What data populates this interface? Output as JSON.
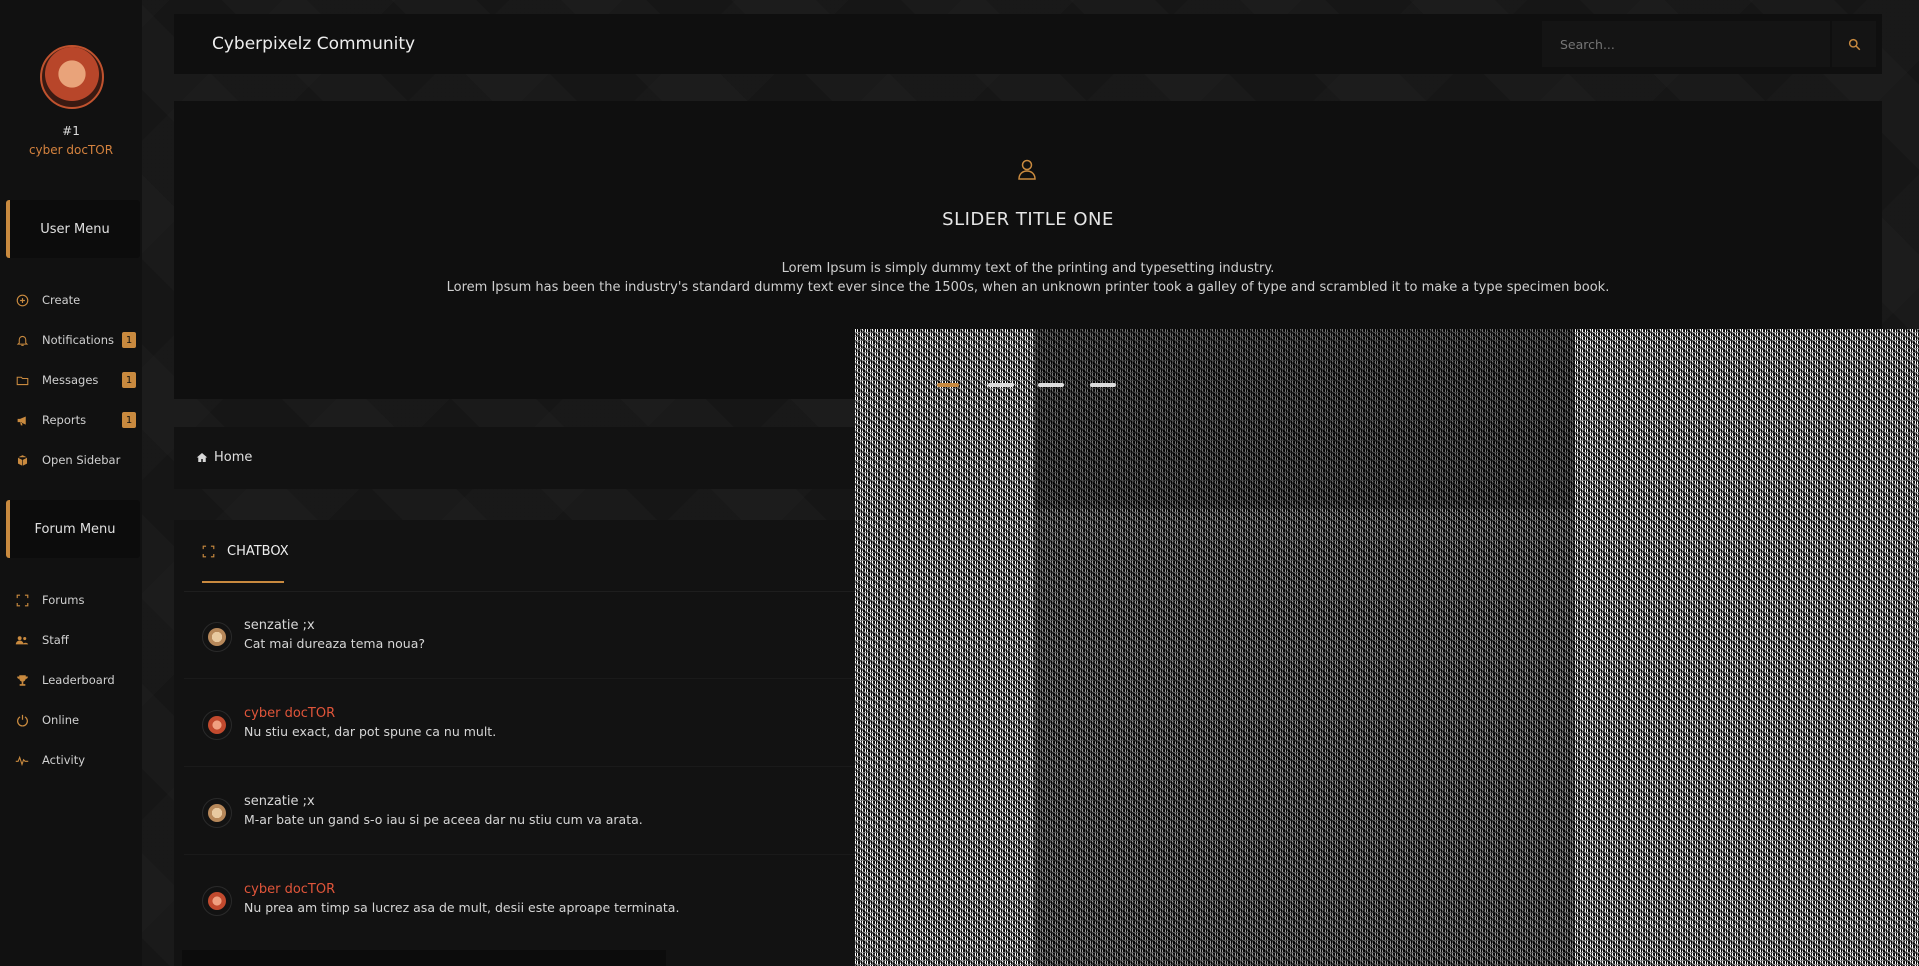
{
  "site": {
    "title": "Cyberpixelz Community"
  },
  "search": {
    "placeholder": "Search..."
  },
  "user": {
    "rank": "#1",
    "name": "cyber docTOR"
  },
  "user_menu": {
    "title": "User Menu",
    "items": [
      {
        "label": "Create",
        "icon": "plus-circle-icon",
        "badge": ""
      },
      {
        "label": "Notifications",
        "icon": "bell-icon",
        "badge": "1"
      },
      {
        "label": "Messages",
        "icon": "folder-icon",
        "badge": "1"
      },
      {
        "label": "Reports",
        "icon": "megaphone-icon",
        "badge": "1"
      },
      {
        "label": "Open Sidebar",
        "icon": "cube-icon",
        "badge": ""
      }
    ]
  },
  "forum_menu": {
    "title": "Forum Menu",
    "items": [
      {
        "label": "Forums",
        "icon": "expand-icon"
      },
      {
        "label": "Staff",
        "icon": "users-icon"
      },
      {
        "label": "Leaderboard",
        "icon": "trophy-icon"
      },
      {
        "label": "Online",
        "icon": "power-icon"
      },
      {
        "label": "Activity",
        "icon": "pulse-icon"
      }
    ]
  },
  "slider": {
    "title": "SLIDER TITLE ONE",
    "line1": "Lorem Ipsum is simply dummy text of the printing and typesetting industry.",
    "line2": "Lorem Ipsum has been the industry's standard dummy text ever since the 1500s, when an unknown printer took a galley of type and scrambled it to make a type specimen book."
  },
  "breadcrumb": {
    "home": "Home"
  },
  "chatbox": {
    "title": "CHATBOX",
    "messages": [
      {
        "user": "senzatie ;x",
        "text": "Cat mai dureaza tema noua?",
        "user_color": "#d8d8d8"
      },
      {
        "user": "cyber docTOR",
        "text": "Nu stiu exact, dar pot spune ca nu mult.",
        "user_color": "#e0553a"
      },
      {
        "user": "senzatie ;x",
        "text": "M-ar bate un gand s-o iau si pe aceea dar nu stiu cum va arata.",
        "user_color": "#d8d8d8"
      },
      {
        "user": "cyber docTOR",
        "text": "Nu prea am timp sa lucrez asa de mult, desii este aproape terminata.",
        "user_color": "#e0553a"
      }
    ]
  },
  "colors": {
    "accent": "#c98a3f",
    "admin": "#e0553a",
    "bg": "#161616",
    "panel": "#0f0f0f"
  }
}
